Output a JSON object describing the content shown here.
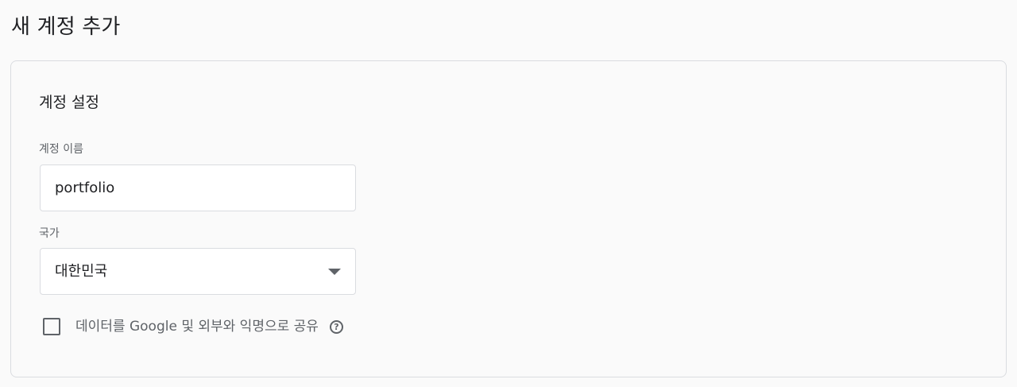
{
  "page": {
    "title": "새 계정 추가"
  },
  "account_settings": {
    "section_title": "계정 설정",
    "account_name": {
      "label": "계정 이름",
      "value": "portfolio"
    },
    "country": {
      "label": "국가",
      "selected": "대한민국",
      "icon": "dropdown-arrow-icon"
    },
    "data_sharing": {
      "label": "데이터를 Google 및 외부와 익명으로 공유",
      "checked": false,
      "help_icon": "help-icon",
      "help_glyph": "?"
    }
  }
}
